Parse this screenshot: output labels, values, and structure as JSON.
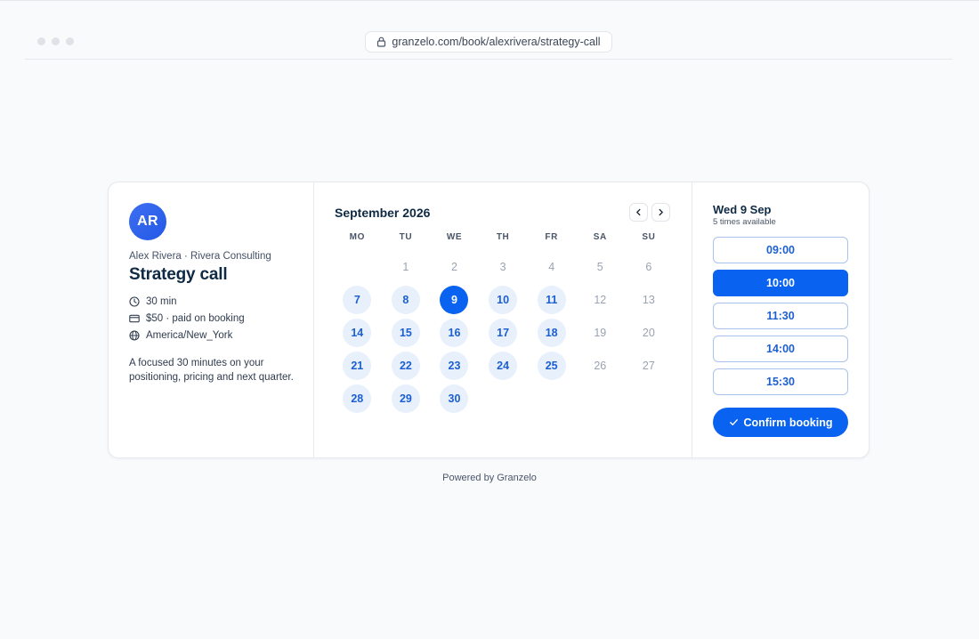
{
  "browser": {
    "url": "granzelo.com/book/alexrivera/strategy-call"
  },
  "host": {
    "initials": "AR",
    "line": "Alex Rivera · Rivera Consulting",
    "event_title": "Strategy call",
    "duration": "30 min",
    "price": "$50 · paid on booking",
    "timezone": "America/New_York",
    "description": "A focused 30 minutes on your positioning, pricing and next quarter."
  },
  "calendar": {
    "month": "September 2026",
    "weekdays": [
      "MO",
      "TU",
      "WE",
      "TH",
      "FR",
      "SA",
      "SU"
    ],
    "days": [
      {
        "label": "",
        "state": "empty"
      },
      {
        "label": "1",
        "state": "muted"
      },
      {
        "label": "2",
        "state": "muted"
      },
      {
        "label": "3",
        "state": "muted"
      },
      {
        "label": "4",
        "state": "muted"
      },
      {
        "label": "5",
        "state": "muted"
      },
      {
        "label": "6",
        "state": "muted"
      },
      {
        "label": "7",
        "state": "available"
      },
      {
        "label": "8",
        "state": "available"
      },
      {
        "label": "9",
        "state": "selected"
      },
      {
        "label": "10",
        "state": "available"
      },
      {
        "label": "11",
        "state": "available"
      },
      {
        "label": "12",
        "state": "muted"
      },
      {
        "label": "13",
        "state": "muted"
      },
      {
        "label": "14",
        "state": "available"
      },
      {
        "label": "15",
        "state": "available"
      },
      {
        "label": "16",
        "state": "available"
      },
      {
        "label": "17",
        "state": "available"
      },
      {
        "label": "18",
        "state": "available"
      },
      {
        "label": "19",
        "state": "muted"
      },
      {
        "label": "20",
        "state": "muted"
      },
      {
        "label": "21",
        "state": "available"
      },
      {
        "label": "22",
        "state": "available"
      },
      {
        "label": "23",
        "state": "available"
      },
      {
        "label": "24",
        "state": "available"
      },
      {
        "label": "25",
        "state": "available"
      },
      {
        "label": "26",
        "state": "muted"
      },
      {
        "label": "27",
        "state": "muted"
      },
      {
        "label": "28",
        "state": "available"
      },
      {
        "label": "29",
        "state": "available"
      },
      {
        "label": "30",
        "state": "available"
      }
    ]
  },
  "times": {
    "selected_date": "Wed 9 Sep",
    "count_text": "5 times available",
    "slots": [
      {
        "label": "09:00",
        "active": false
      },
      {
        "label": "10:00",
        "active": true
      },
      {
        "label": "11:30",
        "active": false
      },
      {
        "label": "14:00",
        "active": false
      },
      {
        "label": "15:30",
        "active": false
      }
    ],
    "confirm_label": "Confirm booking"
  },
  "footer": {
    "powered_by": "Powered by Granzelo"
  },
  "colors": {
    "accent": "#0a63f0",
    "available_bg": "#e8f0fc",
    "text_primary": "#0f2a44"
  }
}
